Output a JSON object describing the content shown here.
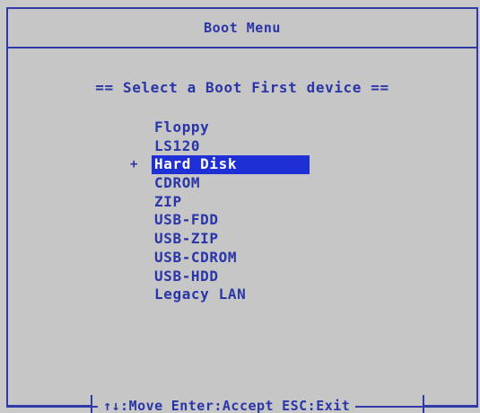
{
  "window": {
    "title": "Boot Menu"
  },
  "heading": "== Select a Boot First device ==",
  "devices": [
    {
      "label": "Floppy"
    },
    {
      "label": "LS120"
    },
    {
      "label": "Hard Disk",
      "selected": true
    },
    {
      "label": "CDROM"
    },
    {
      "label": "ZIP"
    },
    {
      "label": "USB-FDD"
    },
    {
      "label": "USB-ZIP"
    },
    {
      "label": "USB-CDROM"
    },
    {
      "label": "USB-HDD"
    },
    {
      "label": "Legacy LAN"
    }
  ],
  "selection_marker": "+",
  "footer": {
    "move": "↑↓:Move",
    "accept": "Enter:Accept",
    "exit": "ESC:Exit"
  },
  "colors": {
    "text": "#2a35a8",
    "border": "#2f3aa6",
    "highlight": "#1f2fd6",
    "background": "#c6c6c6"
  }
}
